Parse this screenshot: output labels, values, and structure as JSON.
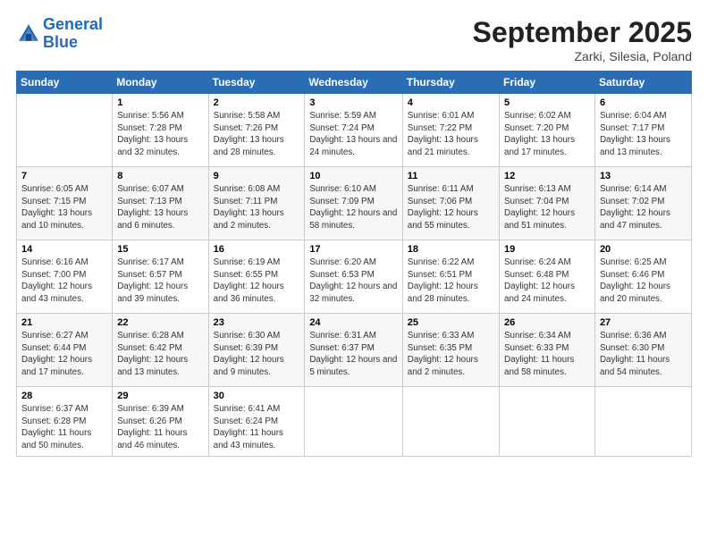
{
  "header": {
    "logo_line1": "General",
    "logo_line2": "Blue",
    "month": "September 2025",
    "location": "Zarki, Silesia, Poland"
  },
  "weekdays": [
    "Sunday",
    "Monday",
    "Tuesday",
    "Wednesday",
    "Thursday",
    "Friday",
    "Saturday"
  ],
  "weeks": [
    [
      {
        "day": "",
        "sunrise": "",
        "sunset": "",
        "daylight": ""
      },
      {
        "day": "1",
        "sunrise": "Sunrise: 5:56 AM",
        "sunset": "Sunset: 7:28 PM",
        "daylight": "Daylight: 13 hours and 32 minutes."
      },
      {
        "day": "2",
        "sunrise": "Sunrise: 5:58 AM",
        "sunset": "Sunset: 7:26 PM",
        "daylight": "Daylight: 13 hours and 28 minutes."
      },
      {
        "day": "3",
        "sunrise": "Sunrise: 5:59 AM",
        "sunset": "Sunset: 7:24 PM",
        "daylight": "Daylight: 13 hours and 24 minutes."
      },
      {
        "day": "4",
        "sunrise": "Sunrise: 6:01 AM",
        "sunset": "Sunset: 7:22 PM",
        "daylight": "Daylight: 13 hours and 21 minutes."
      },
      {
        "day": "5",
        "sunrise": "Sunrise: 6:02 AM",
        "sunset": "Sunset: 7:20 PM",
        "daylight": "Daylight: 13 hours and 17 minutes."
      },
      {
        "day": "6",
        "sunrise": "Sunrise: 6:04 AM",
        "sunset": "Sunset: 7:17 PM",
        "daylight": "Daylight: 13 hours and 13 minutes."
      }
    ],
    [
      {
        "day": "7",
        "sunrise": "Sunrise: 6:05 AM",
        "sunset": "Sunset: 7:15 PM",
        "daylight": "Daylight: 13 hours and 10 minutes."
      },
      {
        "day": "8",
        "sunrise": "Sunrise: 6:07 AM",
        "sunset": "Sunset: 7:13 PM",
        "daylight": "Daylight: 13 hours and 6 minutes."
      },
      {
        "day": "9",
        "sunrise": "Sunrise: 6:08 AM",
        "sunset": "Sunset: 7:11 PM",
        "daylight": "Daylight: 13 hours and 2 minutes."
      },
      {
        "day": "10",
        "sunrise": "Sunrise: 6:10 AM",
        "sunset": "Sunset: 7:09 PM",
        "daylight": "Daylight: 12 hours and 58 minutes."
      },
      {
        "day": "11",
        "sunrise": "Sunrise: 6:11 AM",
        "sunset": "Sunset: 7:06 PM",
        "daylight": "Daylight: 12 hours and 55 minutes."
      },
      {
        "day": "12",
        "sunrise": "Sunrise: 6:13 AM",
        "sunset": "Sunset: 7:04 PM",
        "daylight": "Daylight: 12 hours and 51 minutes."
      },
      {
        "day": "13",
        "sunrise": "Sunrise: 6:14 AM",
        "sunset": "Sunset: 7:02 PM",
        "daylight": "Daylight: 12 hours and 47 minutes."
      }
    ],
    [
      {
        "day": "14",
        "sunrise": "Sunrise: 6:16 AM",
        "sunset": "Sunset: 7:00 PM",
        "daylight": "Daylight: 12 hours and 43 minutes."
      },
      {
        "day": "15",
        "sunrise": "Sunrise: 6:17 AM",
        "sunset": "Sunset: 6:57 PM",
        "daylight": "Daylight: 12 hours and 39 minutes."
      },
      {
        "day": "16",
        "sunrise": "Sunrise: 6:19 AM",
        "sunset": "Sunset: 6:55 PM",
        "daylight": "Daylight: 12 hours and 36 minutes."
      },
      {
        "day": "17",
        "sunrise": "Sunrise: 6:20 AM",
        "sunset": "Sunset: 6:53 PM",
        "daylight": "Daylight: 12 hours and 32 minutes."
      },
      {
        "day": "18",
        "sunrise": "Sunrise: 6:22 AM",
        "sunset": "Sunset: 6:51 PM",
        "daylight": "Daylight: 12 hours and 28 minutes."
      },
      {
        "day": "19",
        "sunrise": "Sunrise: 6:24 AM",
        "sunset": "Sunset: 6:48 PM",
        "daylight": "Daylight: 12 hours and 24 minutes."
      },
      {
        "day": "20",
        "sunrise": "Sunrise: 6:25 AM",
        "sunset": "Sunset: 6:46 PM",
        "daylight": "Daylight: 12 hours and 20 minutes."
      }
    ],
    [
      {
        "day": "21",
        "sunrise": "Sunrise: 6:27 AM",
        "sunset": "Sunset: 6:44 PM",
        "daylight": "Daylight: 12 hours and 17 minutes."
      },
      {
        "day": "22",
        "sunrise": "Sunrise: 6:28 AM",
        "sunset": "Sunset: 6:42 PM",
        "daylight": "Daylight: 12 hours and 13 minutes."
      },
      {
        "day": "23",
        "sunrise": "Sunrise: 6:30 AM",
        "sunset": "Sunset: 6:39 PM",
        "daylight": "Daylight: 12 hours and 9 minutes."
      },
      {
        "day": "24",
        "sunrise": "Sunrise: 6:31 AM",
        "sunset": "Sunset: 6:37 PM",
        "daylight": "Daylight: 12 hours and 5 minutes."
      },
      {
        "day": "25",
        "sunrise": "Sunrise: 6:33 AM",
        "sunset": "Sunset: 6:35 PM",
        "daylight": "Daylight: 12 hours and 2 minutes."
      },
      {
        "day": "26",
        "sunrise": "Sunrise: 6:34 AM",
        "sunset": "Sunset: 6:33 PM",
        "daylight": "Daylight: 11 hours and 58 minutes."
      },
      {
        "day": "27",
        "sunrise": "Sunrise: 6:36 AM",
        "sunset": "Sunset: 6:30 PM",
        "daylight": "Daylight: 11 hours and 54 minutes."
      }
    ],
    [
      {
        "day": "28",
        "sunrise": "Sunrise: 6:37 AM",
        "sunset": "Sunset: 6:28 PM",
        "daylight": "Daylight: 11 hours and 50 minutes."
      },
      {
        "day": "29",
        "sunrise": "Sunrise: 6:39 AM",
        "sunset": "Sunset: 6:26 PM",
        "daylight": "Daylight: 11 hours and 46 minutes."
      },
      {
        "day": "30",
        "sunrise": "Sunrise: 6:41 AM",
        "sunset": "Sunset: 6:24 PM",
        "daylight": "Daylight: 11 hours and 43 minutes."
      },
      {
        "day": "",
        "sunrise": "",
        "sunset": "",
        "daylight": ""
      },
      {
        "day": "",
        "sunrise": "",
        "sunset": "",
        "daylight": ""
      },
      {
        "day": "",
        "sunrise": "",
        "sunset": "",
        "daylight": ""
      },
      {
        "day": "",
        "sunrise": "",
        "sunset": "",
        "daylight": ""
      }
    ]
  ]
}
